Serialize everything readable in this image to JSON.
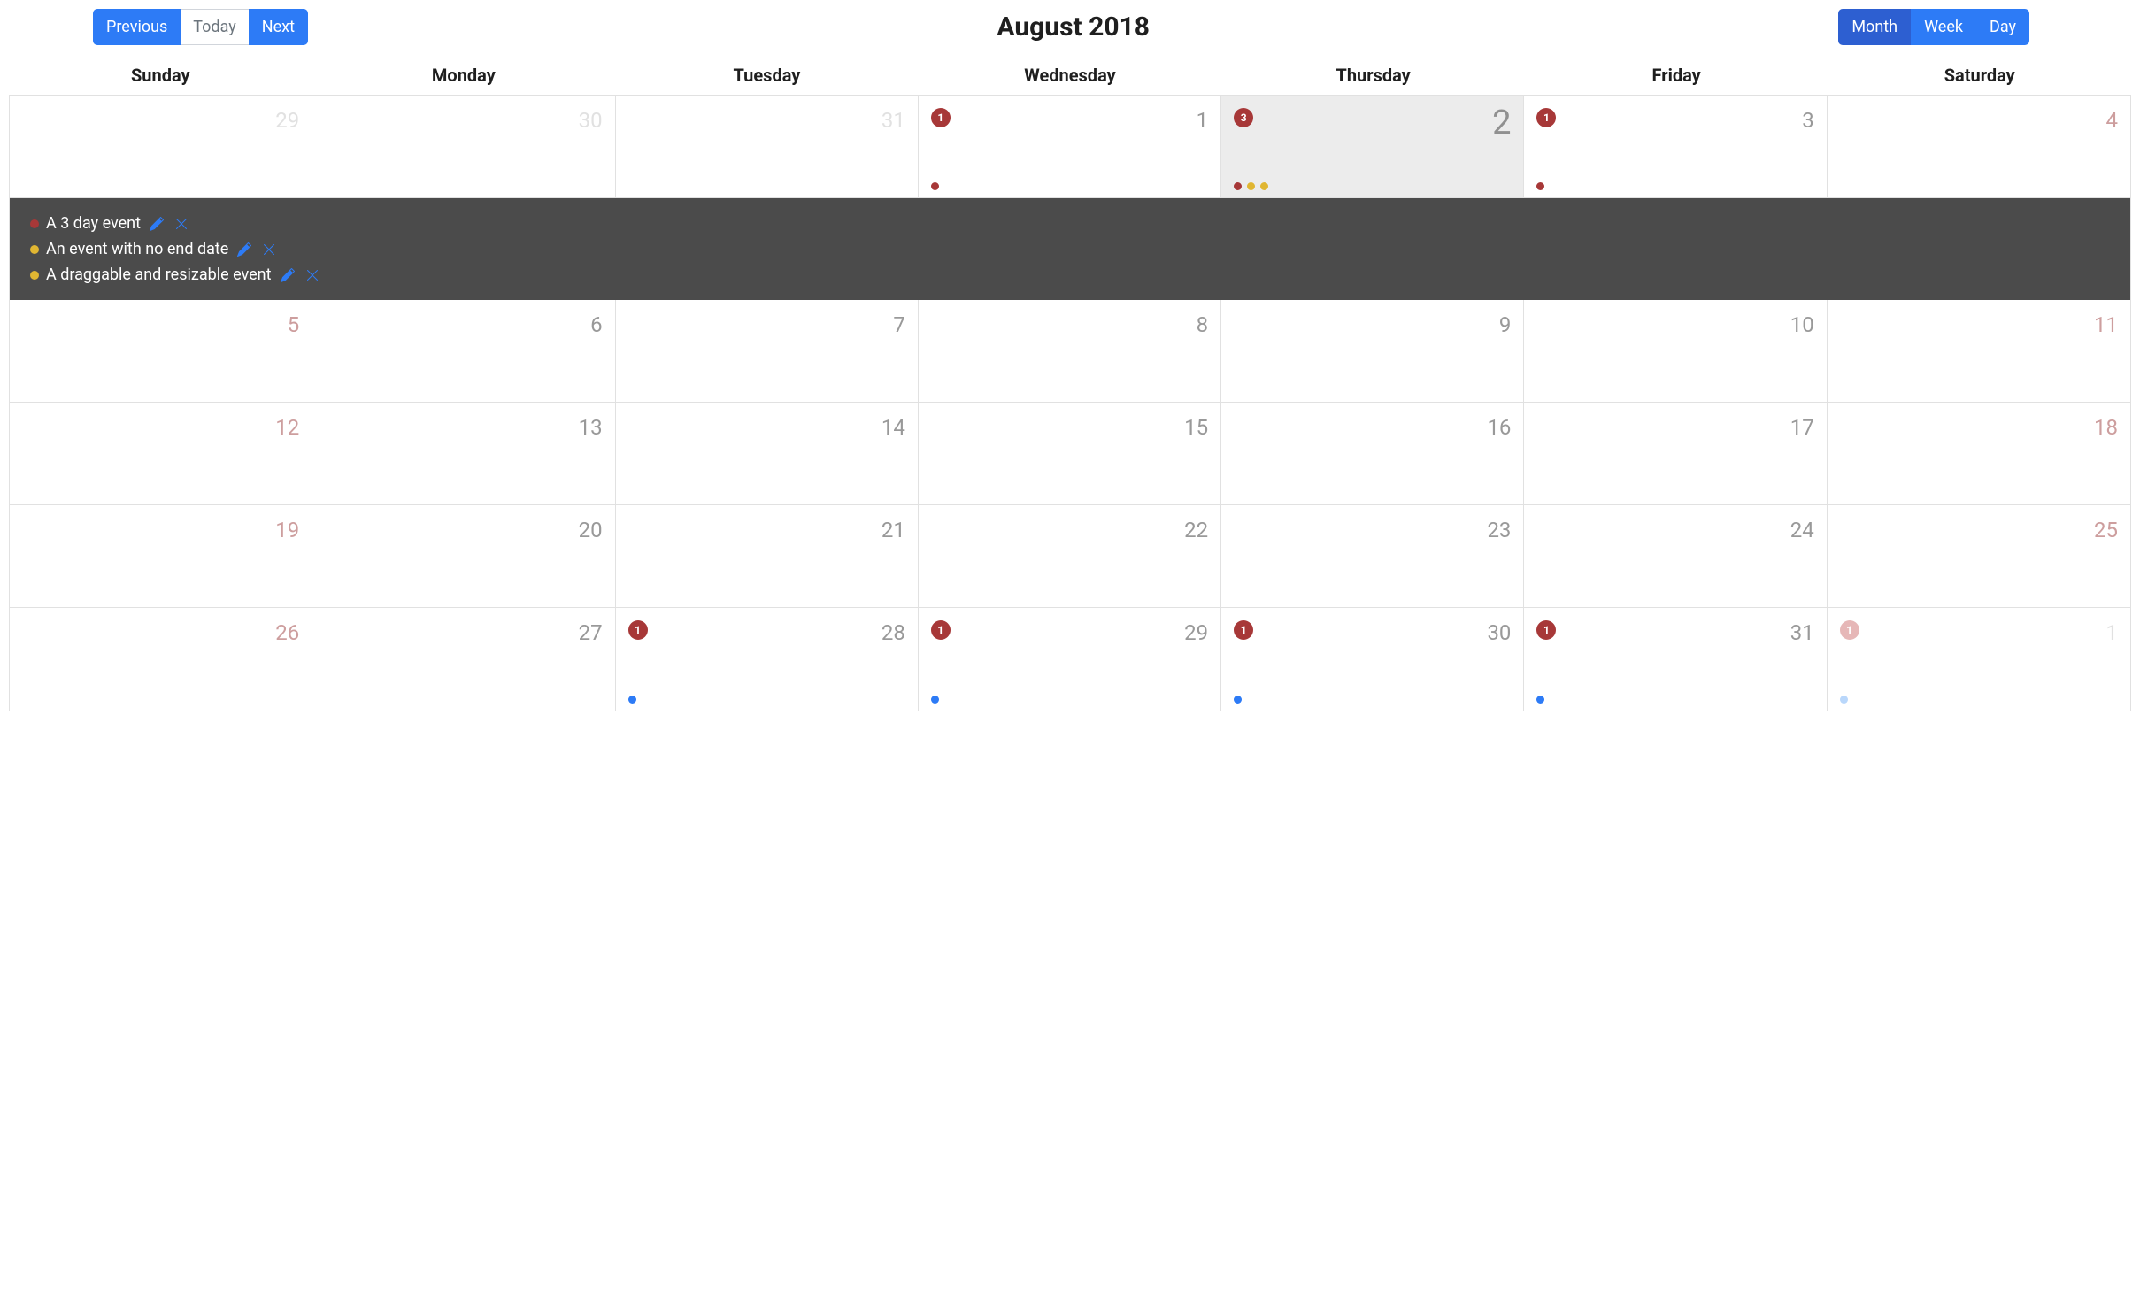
{
  "toolbar": {
    "previous_label": "Previous",
    "today_label": "Today",
    "next_label": "Next",
    "title": "August 2018",
    "month_label": "Month",
    "week_label": "Week",
    "day_label": "Day",
    "active_view": "Month"
  },
  "day_headers": [
    "Sunday",
    "Monday",
    "Tuesday",
    "Wednesday",
    "Thursday",
    "Friday",
    "Saturday"
  ],
  "colors": {
    "primary_blue": "#2d7bf6",
    "badge_red": "#a73838",
    "dot_yellow": "#e0b632"
  },
  "weeks": [
    [
      {
        "num": "29",
        "out_month": true,
        "weekend": true
      },
      {
        "num": "30",
        "out_month": true
      },
      {
        "num": "31",
        "out_month": true
      },
      {
        "num": "1",
        "badge": {
          "text": "1",
          "color": "red"
        },
        "dots": [
          "red"
        ]
      },
      {
        "num": "2",
        "today": true,
        "badge": {
          "text": "3",
          "color": "red"
        },
        "dots": [
          "red",
          "yellow",
          "yellow"
        ]
      },
      {
        "num": "3",
        "badge": {
          "text": "1",
          "color": "red"
        },
        "dots": [
          "red"
        ]
      },
      {
        "num": "4",
        "weekend": true
      }
    ],
    [
      {
        "num": "5",
        "weekend": true
      },
      {
        "num": "6"
      },
      {
        "num": "7"
      },
      {
        "num": "8"
      },
      {
        "num": "9"
      },
      {
        "num": "10"
      },
      {
        "num": "11",
        "weekend": true
      }
    ],
    [
      {
        "num": "12",
        "weekend": true
      },
      {
        "num": "13"
      },
      {
        "num": "14"
      },
      {
        "num": "15"
      },
      {
        "num": "16"
      },
      {
        "num": "17"
      },
      {
        "num": "18",
        "weekend": true
      }
    ],
    [
      {
        "num": "19",
        "weekend": true
      },
      {
        "num": "20"
      },
      {
        "num": "21"
      },
      {
        "num": "22"
      },
      {
        "num": "23"
      },
      {
        "num": "24"
      },
      {
        "num": "25",
        "weekend": true
      }
    ],
    [
      {
        "num": "26",
        "weekend": true
      },
      {
        "num": "27"
      },
      {
        "num": "28",
        "badge": {
          "text": "1",
          "color": "red"
        },
        "dots": [
          "blue"
        ]
      },
      {
        "num": "29",
        "badge": {
          "text": "1",
          "color": "red"
        },
        "dots": [
          "blue"
        ]
      },
      {
        "num": "30",
        "badge": {
          "text": "1",
          "color": "red"
        },
        "dots": [
          "blue"
        ]
      },
      {
        "num": "31",
        "badge": {
          "text": "1",
          "color": "red"
        },
        "dots": [
          "blue"
        ]
      },
      {
        "num": "1",
        "out_month": true,
        "badge": {
          "text": "1",
          "color": "lightred"
        },
        "dots": [
          "lightblue"
        ]
      }
    ]
  ],
  "expanded_day_index": {
    "week": 0,
    "day": 4
  },
  "expanded_events": [
    {
      "color": "red",
      "title": "A 3 day event"
    },
    {
      "color": "yellow",
      "title": "An event with no end date"
    },
    {
      "color": "yellow",
      "title": "A draggable and resizable event"
    }
  ]
}
